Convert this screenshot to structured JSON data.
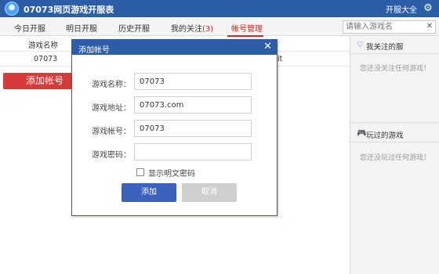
{
  "app": {
    "title": "07073网页游戏开服表",
    "right_link": "开服大全"
  },
  "tabs": [
    {
      "label": "今日开服"
    },
    {
      "label": "明日开服"
    },
    {
      "label": "历史开服"
    },
    {
      "label": "我的关注",
      "count": "(3)"
    },
    {
      "label": "帐号管理"
    }
  ],
  "search": {
    "placeholder": "请输入游戏名"
  },
  "grid": {
    "header": "游戏名称",
    "row": {
      "name": "07073",
      "trailing": "it"
    }
  },
  "add_button": "添加帐号",
  "sidebar": {
    "followed": {
      "title": "我关注的服",
      "empty": "您还没关注任何游戏！"
    },
    "played": {
      "title": "玩过的游戏",
      "empty": "您还没玩过任何游戏！"
    }
  },
  "dialog": {
    "title": "添加帐号",
    "fields": [
      {
        "label": "游戏名称：",
        "value": "07073"
      },
      {
        "label": "游戏地址：",
        "value": "07073.com"
      },
      {
        "label": "游戏帐号：",
        "value": "07073"
      },
      {
        "label": "游戏密码：",
        "value": ""
      }
    ],
    "show_password_label": "显示明文密码",
    "ok": "添加",
    "cancel": "取消"
  },
  "colors": {
    "primary": "#2c5ea8",
    "accent": "#d63a3a",
    "sidebar_bg": "#f3f3f3"
  }
}
